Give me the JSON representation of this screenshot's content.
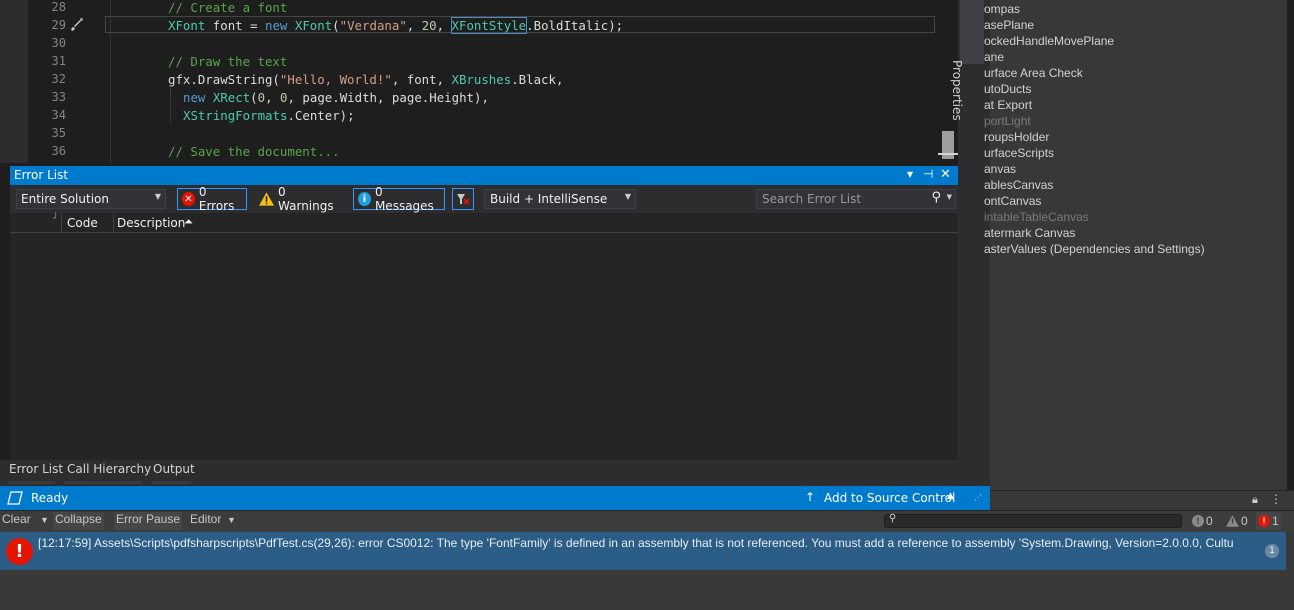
{
  "editor": {
    "lines": [
      {
        "num": "28",
        "tokens": [
          {
            "t": "// Create a font",
            "c": "c-com"
          }
        ],
        "indent": 60
      },
      {
        "num": "29",
        "tokens": [
          {
            "t": "XFont",
            "c": "c-type"
          },
          {
            "t": " font = ",
            "c": ""
          },
          {
            "t": "new",
            "c": "c-kw"
          },
          {
            "t": " ",
            "c": ""
          },
          {
            "t": "XFont",
            "c": "c-type"
          },
          {
            "t": "(",
            "c": ""
          },
          {
            "t": "\"Verdana\"",
            "c": "c-str"
          },
          {
            "t": ", ",
            "c": ""
          },
          {
            "t": "20",
            "c": "c-num"
          },
          {
            "t": ", ",
            "c": ""
          },
          {
            "t": "XFontStyle",
            "c": "c-type"
          },
          {
            "t": ".BoldItalic);",
            "c": ""
          }
        ],
        "indent": 60
      },
      {
        "num": "30",
        "tokens": [],
        "indent": 60
      },
      {
        "num": "31",
        "tokens": [
          {
            "t": "// Draw the text",
            "c": "c-com"
          }
        ],
        "indent": 60
      },
      {
        "num": "32",
        "tokens": [
          {
            "t": "gfx.DrawString(",
            "c": ""
          },
          {
            "t": "\"Hello, World!\"",
            "c": "c-str"
          },
          {
            "t": ", font, ",
            "c": ""
          },
          {
            "t": "XBrushes",
            "c": "c-type"
          },
          {
            "t": ".Black,",
            "c": ""
          }
        ],
        "indent": 60
      },
      {
        "num": "33",
        "tokens": [
          {
            "t": "new",
            "c": "c-kw"
          },
          {
            "t": " ",
            "c": ""
          },
          {
            "t": "XRect",
            "c": "c-type"
          },
          {
            "t": "(",
            "c": ""
          },
          {
            "t": "0",
            "c": "c-num"
          },
          {
            "t": ", ",
            "c": ""
          },
          {
            "t": "0",
            "c": "c-num"
          },
          {
            "t": ", page.Width, page.Height),",
            "c": ""
          }
        ],
        "indent": 75
      },
      {
        "num": "34",
        "tokens": [
          {
            "t": "XStringFormats",
            "c": "c-type"
          },
          {
            "t": ".Center);",
            "c": ""
          }
        ],
        "indent": 75
      },
      {
        "num": "35",
        "tokens": [],
        "indent": 60
      },
      {
        "num": "36",
        "tokens": [
          {
            "t": "// Save the document...",
            "c": "c-com"
          }
        ],
        "indent": 60
      }
    ]
  },
  "properties_tab": "Properties",
  "error_list": {
    "title": "Error List",
    "scope": "Entire Solution",
    "errors_label": "0 Errors",
    "warnings_label": "0 Warnings",
    "messages_label": "0 Messages",
    "build_filter": "Build + IntelliSense",
    "search_placeholder": "Search Error List",
    "col_code": "Code",
    "col_description": "Description"
  },
  "bottom_tabs": [
    "Error List",
    "Call Hierarchy",
    "Output"
  ],
  "status": {
    "ready": "Ready",
    "source_control": "Add to Source Control"
  },
  "hierarchy": {
    "items": [
      {
        "label": "ompas",
        "dim": false
      },
      {
        "label": "asePlane",
        "dim": false
      },
      {
        "label": "ockedHandleMovePlane",
        "dim": false
      },
      {
        "label": "ane",
        "dim": false
      },
      {
        "label": "urface Area Check",
        "dim": false
      },
      {
        "label": "utoDucts",
        "dim": false
      },
      {
        "label": "at Export",
        "dim": false
      },
      {
        "label": "portLight",
        "dim": true
      },
      {
        "label": "roupsHolder",
        "dim": false
      },
      {
        "label": "urfaceScripts",
        "dim": false
      },
      {
        "label": "anvas",
        "dim": false
      },
      {
        "label": "ablesCanvas",
        "dim": false
      },
      {
        "label": "ontCanvas",
        "dim": false
      },
      {
        "label": "intableTableCanvas",
        "dim": true
      },
      {
        "label": "atermark Canvas",
        "dim": false
      },
      {
        "label": "asterValues (Dependencies and Settings)",
        "dim": false
      }
    ]
  },
  "console": {
    "clear": "Clear",
    "collapse": "Collapse",
    "error_pause": "Error Pause",
    "editor": "Editor",
    "log_count": "0",
    "warn_count": "0",
    "error_count": "1",
    "message": "[12:17:59] Assets\\Scripts\\pdfsharpscripts\\PdfTest.cs(29,26): error CS0012: The type 'FontFamily' is defined in an assembly that is not referenced. You must add a reference to assembly 'System.Drawing, Version=2.0.0.0, Cultu",
    "row_count": "1"
  },
  "colors": {
    "vs_accent": "#007acc",
    "error_red": "#e51400",
    "console_selected": "#2c5d87"
  }
}
